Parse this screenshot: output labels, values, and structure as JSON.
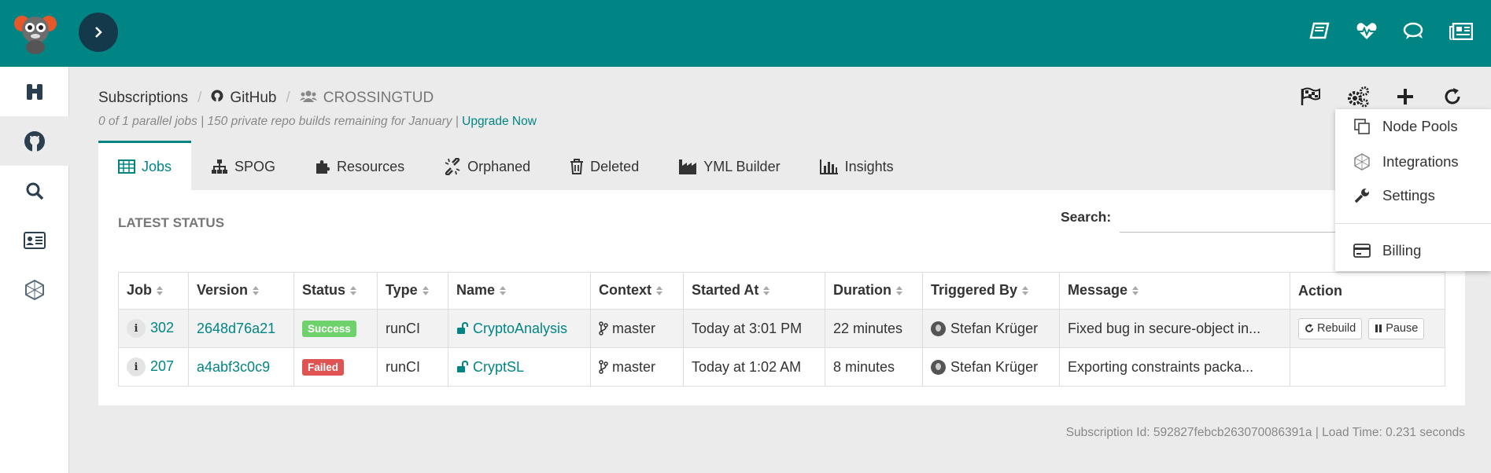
{
  "breadcrumb": {
    "root": "Subscriptions",
    "provider": "GitHub",
    "org": "CROSSINGTUD"
  },
  "subline": {
    "text": "0 of 1 parallel jobs | 150 private repo builds remaining for January |",
    "upgrade": "Upgrade Now"
  },
  "tabs": [
    {
      "label": "Jobs",
      "icon": "table-icon",
      "active": true
    },
    {
      "label": "SPOG",
      "icon": "sitemap-icon"
    },
    {
      "label": "Resources",
      "icon": "puzzle-icon"
    },
    {
      "label": "Orphaned",
      "icon": "unlink-icon"
    },
    {
      "label": "Deleted",
      "icon": "trash-icon"
    },
    {
      "label": "YML Builder",
      "icon": "industry-icon"
    },
    {
      "label": "Insights",
      "icon": "bar-chart-icon"
    }
  ],
  "panel": {
    "title": "LATEST STATUS",
    "search_label": "Search:",
    "search_value": ""
  },
  "table": {
    "headers": [
      "Job",
      "Version",
      "Status",
      "Type",
      "Name",
      "Context",
      "Started At",
      "Duration",
      "Triggered By",
      "Message",
      "Action"
    ],
    "rows": [
      {
        "job": "302",
        "version": "2648d76a21",
        "status": "Success",
        "type": "runCI",
        "name": "CryptoAnalysis",
        "context": "master",
        "started": "Today at 3:01 PM",
        "duration": "22 minutes",
        "triggered": "Stefan Krüger",
        "message": "Fixed bug in secure-object in...",
        "actions": [
          "Rebuild",
          "Pause"
        ]
      },
      {
        "job": "207",
        "version": "a4abf3c0c9",
        "status": "Failed",
        "type": "runCI",
        "name": "CryptSL",
        "context": "master",
        "started": "Today at 1:02 AM",
        "duration": "8 minutes",
        "triggered": "Stefan Krüger",
        "message": "Exporting constraints packa...",
        "actions": []
      }
    ]
  },
  "dropdown": {
    "items": [
      {
        "label": "Node Pools",
        "icon": "copy-icon"
      },
      {
        "label": "Integrations",
        "icon": "hexagon-icon"
      },
      {
        "label": "Settings",
        "icon": "wrench-icon"
      },
      {
        "label": "Billing",
        "icon": "credit-card-icon"
      }
    ]
  },
  "footer": {
    "text": "Subscription Id: 592827febcb263070086391a | Load Time: 0.231 seconds"
  },
  "colors": {
    "brand": "#008584",
    "success": "#6fd16c",
    "failed": "#e05353"
  }
}
